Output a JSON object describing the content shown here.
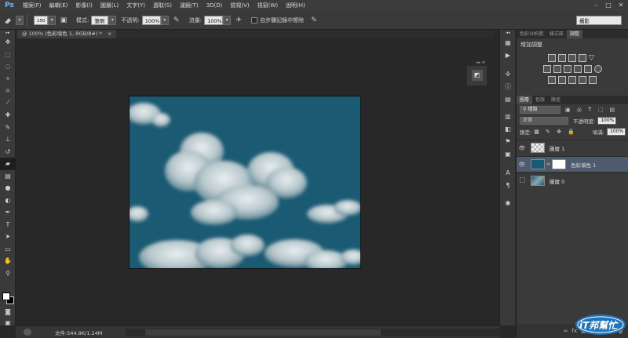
{
  "app": {
    "logo": "Ps",
    "menus": [
      "檔案(F)",
      "編輯(E)",
      "影像(I)",
      "圖層(L)",
      "文字(Y)",
      "選取(S)",
      "濾鏡(T)",
      "3D(D)",
      "檢視(V)",
      "視窗(W)",
      "說明(H)"
    ],
    "window_controls": [
      "–",
      "□",
      "✕"
    ]
  },
  "options": {
    "brush_size": "150",
    "mode_label": "模式:",
    "mode_value": "筆刷",
    "opacity_label": "不透明:",
    "opacity_value": "100%",
    "flow_label": "流量:",
    "flow_value": "100%",
    "history_label": "自步驟記錄中擦除",
    "workspace": "攝影"
  },
  "document": {
    "tab_title": "@ 100% (色彩填色 1, RGB/8#) *",
    "tab_close": "×"
  },
  "status": {
    "doc_info": "文件:544.9K/1.24M"
  },
  "panels": {
    "tabs_top": [
      "色彩分析圖",
      "樣式區",
      "調整"
    ],
    "active_top": "調整",
    "adjust_title": "增加調整",
    "tabs_layers": [
      "圖層",
      "色版",
      "路徑"
    ],
    "active_layers": "圖層",
    "kind_filter": "種類",
    "blend_mode": "正常",
    "opacity_label": "不透明度:",
    "opacity_value": "100%",
    "lock_label": "鎖定:",
    "fill_label": "填滿:",
    "fill_value": "100%",
    "layers": [
      {
        "name": "圖層 1",
        "visible": true,
        "selected": false
      },
      {
        "name": "色彩填色 1",
        "visible": true,
        "selected": true
      },
      {
        "name": "圖層 0",
        "visible": false,
        "selected": false
      }
    ]
  },
  "watermark": {
    "text": "iT邦幫忙"
  },
  "colors": {
    "canvas_blue": "#1b5a73",
    "selection": "#4e5a6e",
    "foreground": "#ffffff",
    "background": "#000000"
  }
}
